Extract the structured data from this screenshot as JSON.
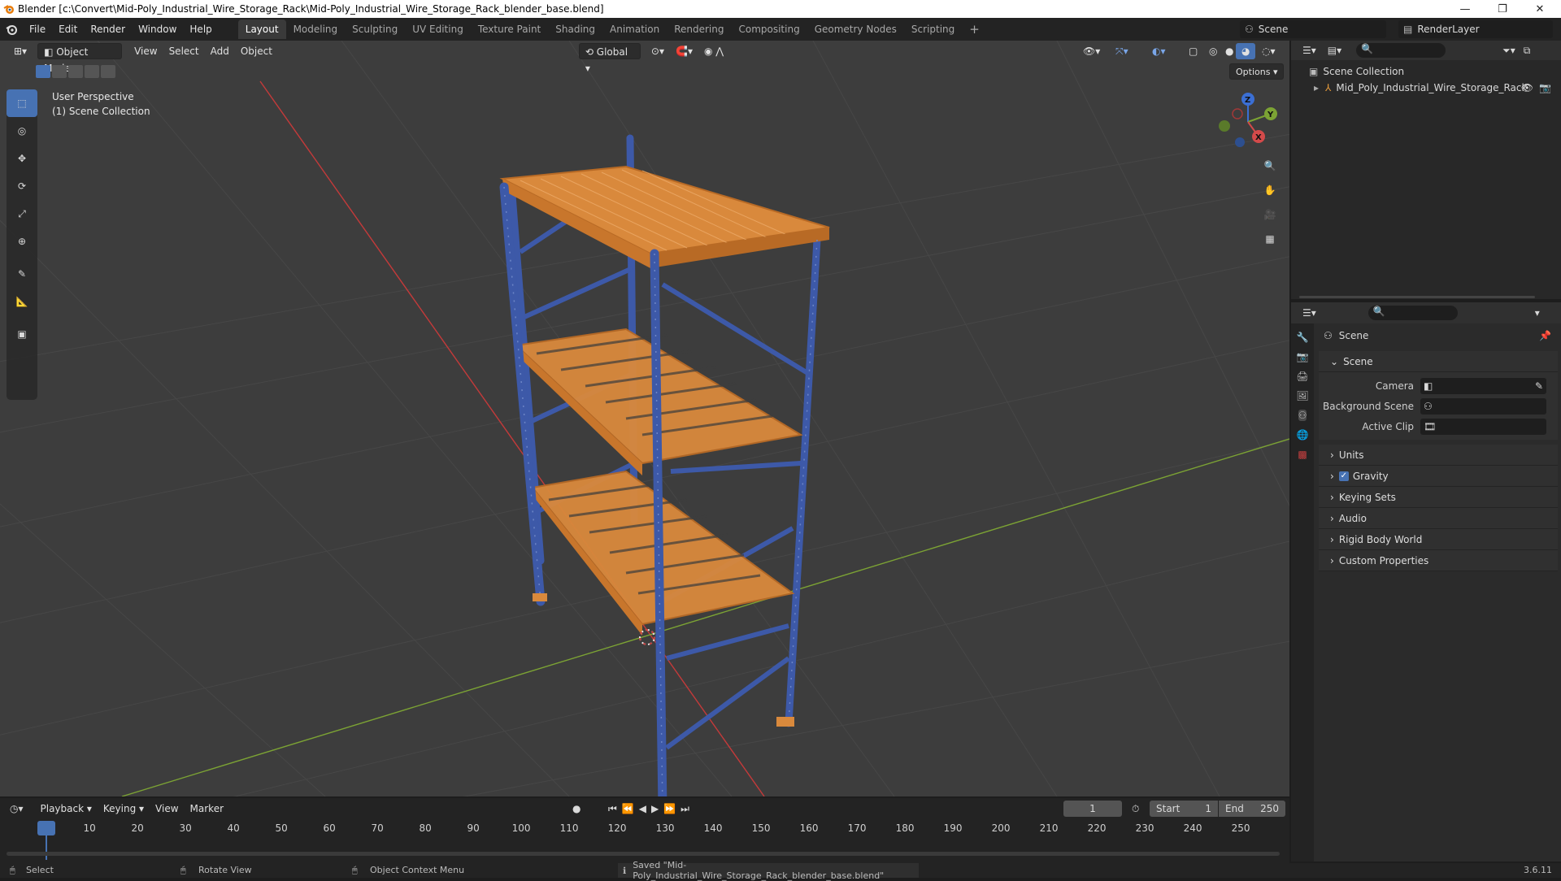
{
  "window": {
    "title": "Blender [c:\\Convert\\Mid-Poly_Industrial_Wire_Storage_Rack\\Mid-Poly_Industrial_Wire_Storage_Rack_blender_base.blend]",
    "controls": [
      "—",
      "❐",
      "✕"
    ]
  },
  "menubar": {
    "menus": [
      "File",
      "Edit",
      "Render",
      "Window",
      "Help"
    ],
    "workspaces": [
      "Layout",
      "Modeling",
      "Sculpting",
      "UV Editing",
      "Texture Paint",
      "Shading",
      "Animation",
      "Rendering",
      "Compositing",
      "Geometry Nodes",
      "Scripting"
    ],
    "active_workspace": "Layout",
    "add_workspace": "+",
    "scene_label": "Scene",
    "render_layer_label": "RenderLayer"
  },
  "viewport": {
    "mode": "Object Mode",
    "menus": [
      "View",
      "Select",
      "Add",
      "Object"
    ],
    "transform_orientation": "Global",
    "options_label": "Options",
    "overlay_line1": "User Perspective",
    "overlay_line2": "(1) Scene Collection",
    "gizmo_axes": {
      "x": "X",
      "y": "Y",
      "z": "Z"
    },
    "colors": {
      "background": "#3d3d3d",
      "x_axis": "#c43a3a",
      "y_axis": "#7ca334",
      "frame": "#3d59a8",
      "shelf": "#d9893c"
    }
  },
  "outliner": {
    "root": "Scene Collection",
    "items": [
      {
        "label": "Mid_Poly_Industrial_Wire_Storage_Rack"
      }
    ]
  },
  "properties": {
    "title": "Scene",
    "section_scene": "Scene",
    "fields": [
      {
        "label": "Camera",
        "value": ""
      },
      {
        "label": "Background Scene",
        "value": ""
      },
      {
        "label": "Active Clip",
        "value": ""
      }
    ],
    "panels": [
      "Units",
      "Gravity",
      "Keying Sets",
      "Audio",
      "Rigid Body World",
      "Custom Properties"
    ],
    "gravity_checked": true
  },
  "timeline": {
    "menus": [
      "Playback",
      "Keying",
      "View",
      "Marker"
    ],
    "current_frame": "1",
    "start_label": "Start",
    "start_value": "1",
    "end_label": "End",
    "end_value": "250",
    "ticks": [
      "1",
      "10",
      "20",
      "30",
      "40",
      "50",
      "60",
      "70",
      "80",
      "90",
      "100",
      "110",
      "120",
      "130",
      "140",
      "150",
      "160",
      "170",
      "180",
      "190",
      "200",
      "210",
      "220",
      "230",
      "240",
      "250"
    ]
  },
  "statusbar": {
    "select": "Select",
    "rotate": "Rotate View",
    "context": "Object Context Menu",
    "message": "Saved \"Mid-Poly_Industrial_Wire_Storage_Rack_blender_base.blend\"",
    "version": "3.6.11"
  }
}
